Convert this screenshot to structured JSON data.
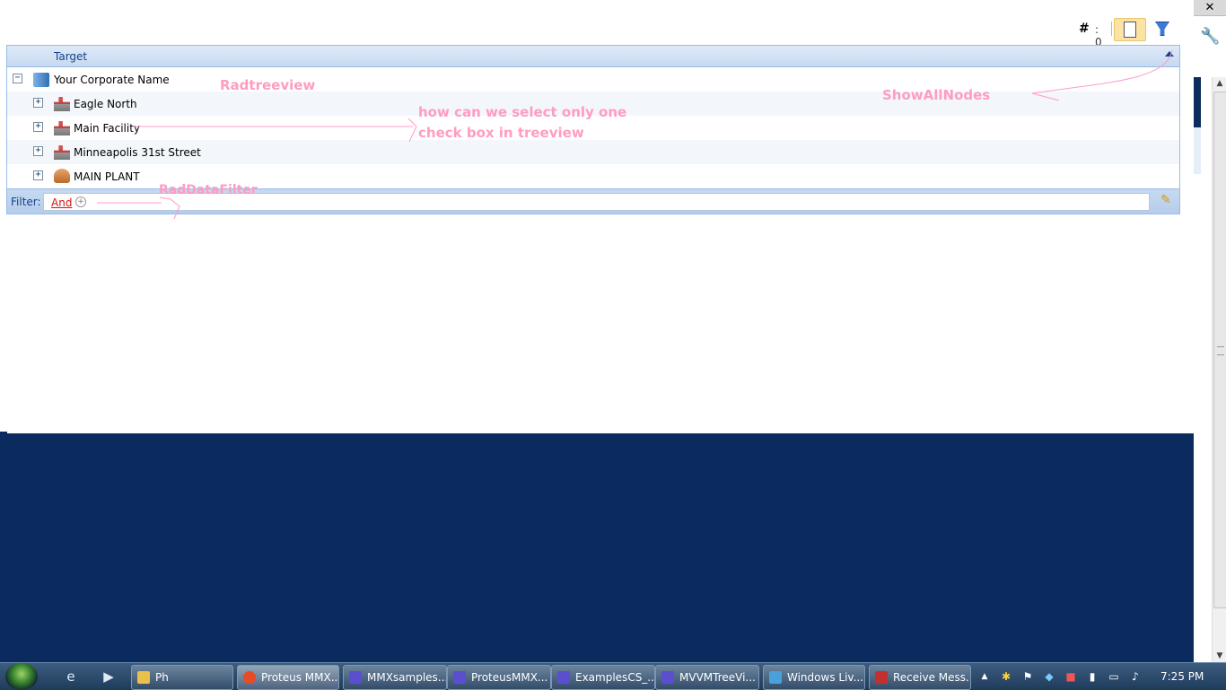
{
  "browser": {
    "close_glyph": "✕",
    "wrench_icon": "wrench-icon",
    "scroll_up": "▲",
    "scroll_down": "▼"
  },
  "toolbar": {
    "check_count_glyph": "#",
    "check_count_value": ": 0"
  },
  "tree": {
    "header": "Target",
    "root": {
      "expander": "−",
      "label": "Your Corporate Name",
      "icon": "corporate-icon"
    },
    "children": [
      {
        "expander": "+",
        "label": "Eagle North",
        "icon": "facility-icon"
      },
      {
        "expander": "+",
        "label": "Main Facility",
        "icon": "facility-icon"
      },
      {
        "expander": "+",
        "label": "Minneapolis 31st Street",
        "icon": "facility-icon"
      },
      {
        "expander": "+",
        "label": "MAIN PLANT",
        "icon": "person-icon"
      }
    ]
  },
  "filter": {
    "label": "Filter:",
    "operator": "And",
    "add_glyph": "+"
  },
  "annotations": {
    "radtreeview": "Radtreeview",
    "question_line1": "how can we select only one",
    "question_line2": "check box in treeview",
    "show_all_nodes": "ShowAllNodes",
    "rad_data_filter": "RadDataFilter",
    "color": "#ff9cc1"
  },
  "taskbar": {
    "buttons": [
      {
        "label": "Ph",
        "color": "#e8c04a"
      },
      {
        "label": "Proteus MMX...",
        "color": "#e44d26"
      },
      {
        "label": "MMXsamples...",
        "color": "#5a4fcf"
      },
      {
        "label": "ProteusMMX...",
        "color": "#5a4fcf"
      },
      {
        "label": "ExamplesCS_...",
        "color": "#5a4fcf"
      },
      {
        "label": "MVVMTreeVi...",
        "color": "#5a4fcf"
      },
      {
        "label": "Windows Liv...",
        "color": "#4aa0d8"
      },
      {
        "label": "Receive Mess...",
        "color": "#c62f2f"
      }
    ],
    "tray_expand": "▲",
    "clock": "7:25 PM"
  },
  "colors": {
    "desktop": "#0b2a5e",
    "header_text": "#15428b",
    "filter_operator": "#dd1111"
  }
}
